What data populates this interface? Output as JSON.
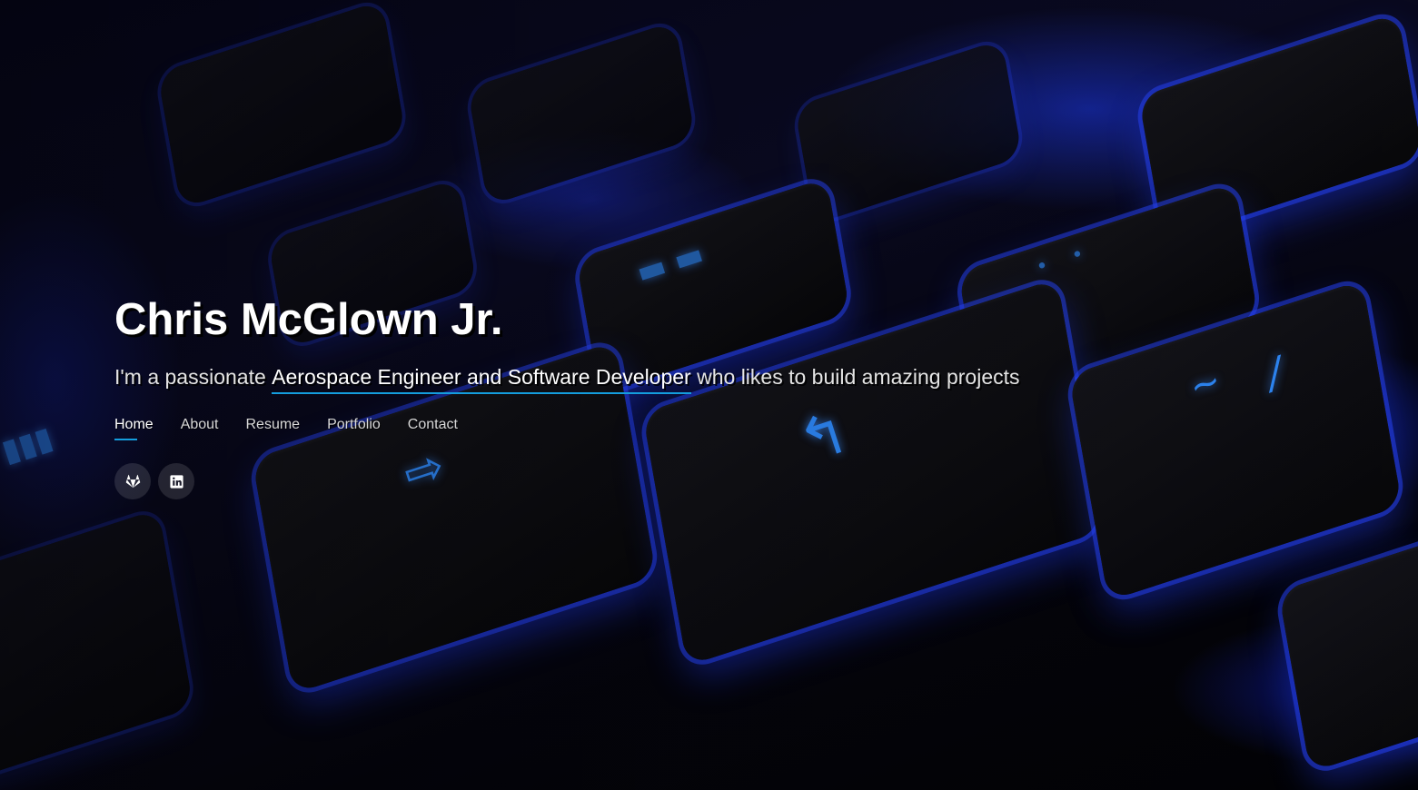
{
  "hero": {
    "name": "Chris McGlown Jr.",
    "tagline_prefix": "I'm a passionate ",
    "tagline_highlight": "Aerospace Engineer and Software Developer",
    "tagline_suffix": " who likes to build amazing projects"
  },
  "nav": {
    "items": [
      {
        "label": "Home",
        "active": true
      },
      {
        "label": "About"
      },
      {
        "label": "Resume"
      },
      {
        "label": "Portfolio"
      },
      {
        "label": "Contact"
      }
    ]
  },
  "social": {
    "links": [
      {
        "icon": "gitlab-icon"
      },
      {
        "icon": "linkedin-icon"
      }
    ]
  },
  "colors": {
    "accent": "#149ddd",
    "text": "#ffffff"
  }
}
